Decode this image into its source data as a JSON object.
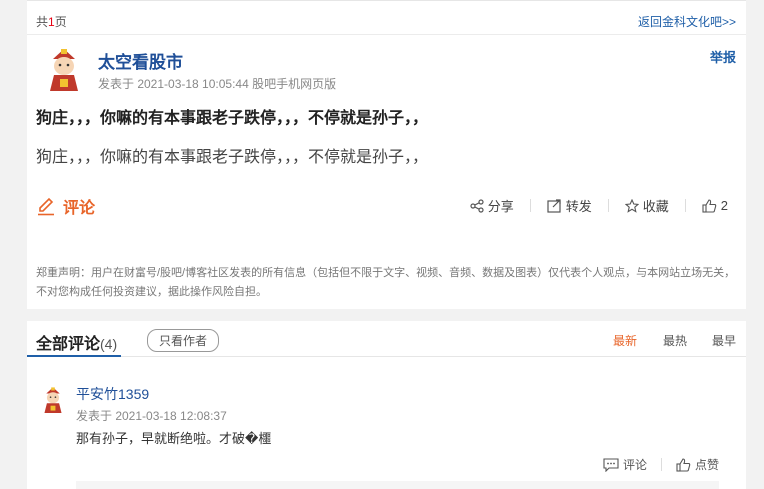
{
  "pager": {
    "prefix": "共",
    "pages": "1",
    "suffix": "页",
    "back_link": "返回金科文化吧>>"
  },
  "post": {
    "author": "太空看股市",
    "meta": "发表于 2021-03-18 10:05:44 股吧手机网页版",
    "report": "举报",
    "title": "狗庄，，，你嘛的有本事跟老子跌停，，，不停就是孙子，，",
    "body": "狗庄，，，你嘛的有本事跟老子跌停，，，不停就是孙子，，",
    "comment_label": "评论",
    "actions": {
      "share": "分享",
      "repost": "转发",
      "favorite": "收藏",
      "like_count": "2"
    },
    "disclaimer": "郑重声明：用户在财富号/股吧/博客社区发表的所有信息（包括但不限于文字、视频、音频、数据及图表）仅代表个人观点，与本网站立场无关，不对您构成任何投资建议，据此操作风险自担。"
  },
  "comments": {
    "title": "全部评论",
    "count": "(4)",
    "author_only": "只看作者",
    "sort": {
      "latest": "最新",
      "hottest": "最热",
      "earliest": "最早"
    },
    "items": [
      {
        "author": "平安竹1359",
        "meta": "发表于 2021-03-18 12:08:37",
        "text": "那有孙子，早就断绝啦。才破�櫮",
        "comment_label": "评论",
        "like_label": "点赞"
      }
    ]
  },
  "colors": {
    "accent": "#e8652a",
    "link": "#1f5fa8",
    "author": "#1f4f98"
  }
}
